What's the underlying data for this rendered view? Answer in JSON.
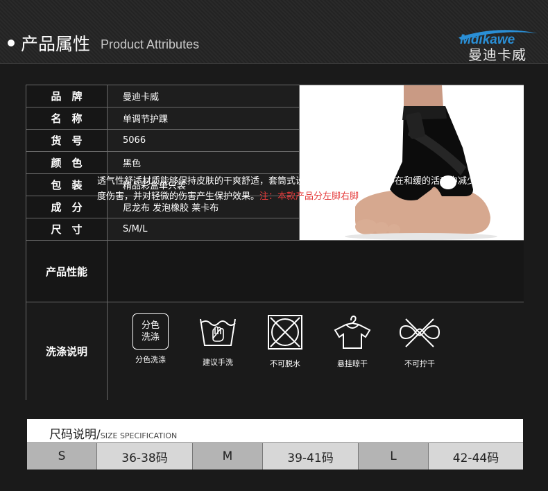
{
  "header": {
    "title_cn": "产品属性",
    "title_en": "Product Attributes",
    "logo_text": "Mdikawe",
    "logo_cn": "曼迪卡威"
  },
  "attributes": [
    {
      "label": "品　牌",
      "value": "曼迪卡威"
    },
    {
      "label": "名　称",
      "value": "单调节护踝"
    },
    {
      "label": "货　号",
      "value": "5066"
    },
    {
      "label": "颜　色",
      "value": "黑色"
    },
    {
      "label": "包　装",
      "value": "精品彩盒单只装"
    },
    {
      "label": "成　分",
      "value": "尼龙布 发泡橡胶 莱卡布"
    },
    {
      "label": "尺　寸",
      "value": "S/M/L"
    }
  ],
  "performance": {
    "label": "产品性能",
    "text": "透气性舒适材质能够保持皮肤的干爽舒适，套筒式设计具有束缚功效，能够在和缓的活动中减少轻度伤害，并对轻微的伤害产生保护效果。",
    "warning": "注：本款产品分左脚右脚"
  },
  "care": {
    "label": "洗涤说明",
    "icon_text": "分色\n洗涤",
    "icon_text_line1": "分色",
    "icon_text_line2": "洗涤",
    "items": [
      {
        "icon": "separate-wash-icon",
        "caption": "分色洗涤"
      },
      {
        "icon": "hand-wash-icon",
        "caption": "建议手洗"
      },
      {
        "icon": "no-tumble-dry-icon",
        "caption": "不可脱水"
      },
      {
        "icon": "hang-dry-icon",
        "caption": "悬挂晾干"
      },
      {
        "icon": "no-wring-icon",
        "caption": "不可拧干"
      }
    ]
  },
  "size_spec": {
    "title_cn": "尺码说明/",
    "title_en": "SIZE SPECIFICATION",
    "cells": [
      "S",
      "36-38码",
      "M",
      "39-41码",
      "L",
      "42-44码"
    ]
  },
  "colors": {
    "background": "#1a1a1a",
    "warning": "#e53a3a",
    "logo_blue": "#2a8fd6"
  }
}
